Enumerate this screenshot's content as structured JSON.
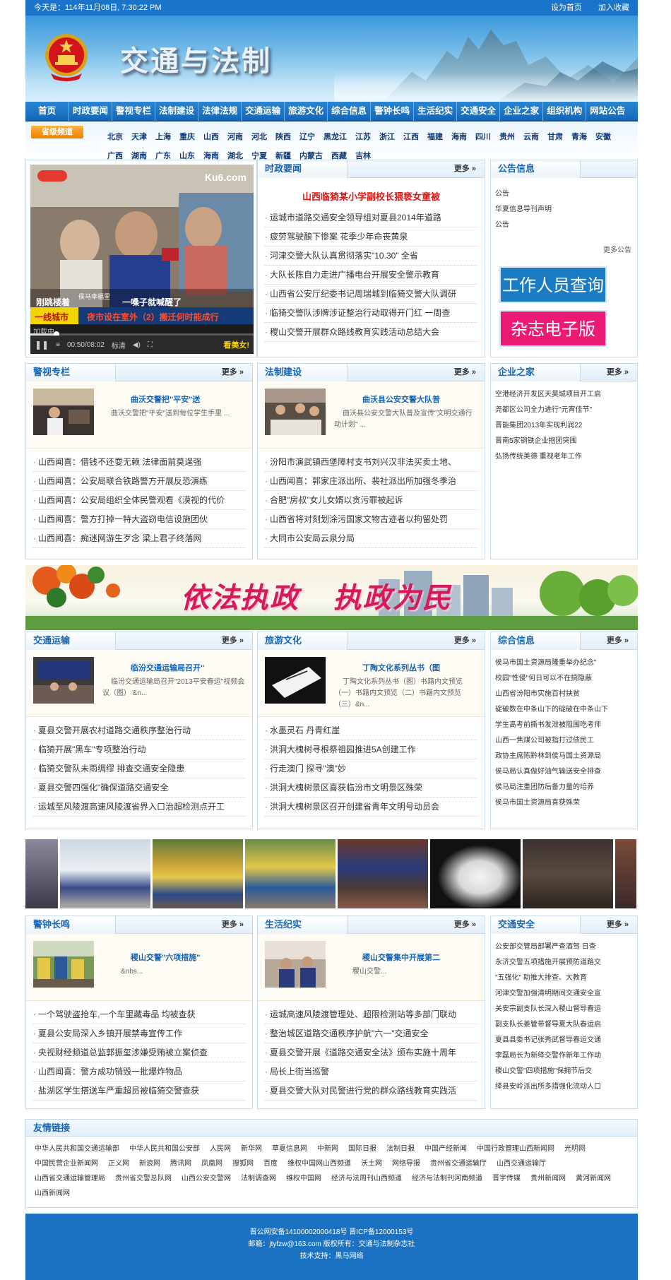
{
  "topbar": {
    "date": "今天是：114年11月08日, 7:30:22 PM",
    "set_home": "设为首页",
    "add_fav": "加入收藏"
  },
  "banner": {
    "title": "交通与法制"
  },
  "nav": [
    "首页",
    "时政要闻",
    "警视专栏",
    "法制建设",
    "法律法规",
    "交通运输",
    "旅游文化",
    "综合信息",
    "警钟长鸣",
    "生活纪实",
    "交通安全",
    "企业之家",
    "组织机构",
    "网站公告"
  ],
  "provinces": {
    "badge": "省级频道",
    "row1": [
      "北京",
      "天津",
      "上海",
      "重庆",
      "山西",
      "河南",
      "河北",
      "陕西",
      "辽宁",
      "黑龙江",
      "江苏",
      "浙江",
      "江西",
      "福建",
      "海南",
      "四川",
      "贵州",
      "云南",
      "甘肃",
      "青海",
      "安徽"
    ],
    "row2": [
      "广西",
      "湖南",
      "广东",
      "山东",
      "海南",
      "湖北",
      "宁夏",
      "新疆",
      "内蒙古",
      "西藏",
      "吉林"
    ]
  },
  "video": {
    "logo": "Ku6.com",
    "news_label": "侯马幸福里",
    "caption_left": "刚跳楼着",
    "caption_right": "一嗓子就喊醒了",
    "ticker_tag": "一线城市",
    "ticker": "夜市设在室外（2）搬迁何时能成行",
    "loading": "加载中",
    "time": "00:50/08:02",
    "quality": "标清",
    "hot": "看美女!"
  },
  "shizheng": {
    "title": "时政要闻",
    "more": "更多",
    "headline": "山西临猗某小学副校长猥亵女童被",
    "items": [
      "运城市道路交通安全领导组对夏县2014年道路",
      "疲劳驾驶酿下惨案 花季少年命丧黄泉",
      "河津交警大队认真贯彻落实\"10.30\" 全省",
      "大队长陈自力走进广播电台开展安全警示教育",
      "山西省公安厅纪委书记周瑞城到临猗交警大队调研",
      "临猗交警队涉牌涉证整治行动取得开门红 一周查",
      "稷山交警开展群众路线教育实践活动总结大会"
    ]
  },
  "notice": {
    "title": "公告信息",
    "items": [
      "公告",
      "华夏信息导刊声明",
      "公告"
    ],
    "more": "更多公告",
    "ad_work": "工作人员查询",
    "ad_mag": "杂志电子版"
  },
  "jingshi": {
    "title": "警视专栏",
    "more": "更多",
    "feat_title": "曲沃交警把\"平安\"送",
    "feat_desc": "曲沃交警把\"平安\"送到每位学生手里   ...",
    "items": [
      "山西闻喜：借钱不还耍无赖 法律面前莫逞强",
      "山西闻喜：公安局联合铁路警方开展反恐演练",
      "山西闻喜：公安局组织全体民警观看《漠视的代价",
      "山西闻喜：警方打掉一特大盗窃电信设施团伙",
      "山西闻喜：痴迷网游生歹念 梁上君子终落网"
    ]
  },
  "fazhi": {
    "title": "法制建设",
    "more": "更多",
    "feat_title": "曲沃县公安交警大队普",
    "feat_desc": "曲沃县公安交警大队普及宣传\"文明交通行动计划\" ...",
    "items": [
      "汾阳市演武镇西堡障村支书刘兴汉非法买卖土地、",
      "山西闻喜：郭家庄派出所、裴社派出所加强冬季治",
      "合肥\"房叔\"女儿女婿以贪污罪被起诉",
      "山西省将对刻划涂污国家文物古迹者以拘留处罚",
      "大同市公安局云泉分局"
    ]
  },
  "qiye": {
    "title": "企业之家",
    "more": "更多",
    "items": [
      "空港经济开发区天昊城项目开工启",
      "尧都区公司全力进行\"元宵佳节\"",
      "晋能集团2013年实现利润22",
      "晋南5家钢铁企业抱团突围",
      "弘扬传统美德 重视老年工作"
    ]
  },
  "ad_band": {
    "slogan1": "依法执政",
    "slogan2": "执政为民"
  },
  "jiaotong": {
    "title": "交通运输",
    "more": "更多",
    "feat_title": "临汾交通运输局召开\"",
    "feat_desc": "临汾交通运输局召开\"2013平安春运\"视频会议（图） &n...",
    "items": [
      "夏县交警开展农村道路交通秩序整治行动",
      "临猗开展\"黑车\"专项整治行动",
      "临猗交警队未雨绸缪 排查交通安全隐患",
      "夏县交警四强化\"确保道路交通安全",
      "运城至风陵渡高速风陵渡省界入口治超检测点开工"
    ]
  },
  "lvyou": {
    "title": "旅游文化",
    "more": "更多",
    "feat_title": "丁陶文化系列丛书（图",
    "feat_desc": "丁陶文化系列丛书（图）书籍内文预览（一）书籍内文预览（二）书籍内文预览（三）&n...",
    "items": [
      "水墨灵石 丹青红崖",
      "洪洞大槐树寻根祭祖园推进5A创建工作",
      "行走澳门 探寻\"澳\"妙",
      "洪洞大槐树景区喜获临汾市文明景区殊荣",
      "洪洞大槐树景区召开创建省青年文明号动员会"
    ]
  },
  "zonghe": {
    "title": "综合信息",
    "more": "更多",
    "items": [
      "侯马市国土资源局隆重举办纪念\"",
      "校园\"性侵\"何日可以不在搞隐蔽",
      "山西省汾阳市实施百村扶贫",
      "碇破数在中条山下的碇破在中条山下",
      "学生高考前撕书发泄被阻围吃考师",
      "山西一焦煤公司被指打过债民工",
      "政协主席陈黔林到侯马国土资源局",
      "侯马局认真做好油气输送安全排查",
      "侯马局注重团防后备力量的培养",
      "侯马市国土资源局喜获殊荣"
    ]
  },
  "jingzhong": {
    "title": "警钟长鸣",
    "more": "更多",
    "feat_title": "稷山交警\"六项措施\"",
    "feat_desc": "&nbs...",
    "items": [
      "一个驾驶盗抢车,一个车里藏毒品 均被查获",
      "夏县公安局深入乡镇开展禁毒宣传工作",
      "央视财经频道总监郭振玺涉嫌受贿被立案侦查",
      "山西闻喜：警方成功销毁一批爆炸物品",
      "盐湖区学生搭送车严重超员被临猗交警查获"
    ]
  },
  "shenghuo": {
    "title": "生活纪实",
    "more": "更多",
    "feat_title": "稷山交警集中开展第二",
    "feat_desc": "稷山交警...",
    "items": [
      "运城高速风陵渡管理处、超限检测站等多部门联动",
      "整治城区道路交通秩序护航\"六一\"交通安全",
      "夏县交警开展《道路交通安全法》颁布实施十周年",
      "局长上街当巡警",
      "夏县交警大队对民警进行党的群众路线教育实践活"
    ]
  },
  "anquan": {
    "title": "交通安全",
    "more": "更多",
    "items": [
      "公安部交管局部署严查酒驾 日查",
      "永济交警五项措施开展预防道路交",
      "\"五强化\" 助推大排查、大教育",
      "河津交警加强清明期间交通安全宣",
      "关安宗副支队长深入稷山督导春运",
      "副支队长姜管带督导夏大队春运启",
      "夏县县委书记张秀武督导春运交通",
      "李磊局长为新绛交警作新年工作动",
      "稷山交警\"四项措施\"保拥节后交",
      "绛县安岭派出所多措强化流动人口"
    ]
  },
  "links": {
    "title": "友情链接",
    "items": [
      "中华人民共和国交通运输部",
      "中华人民共和国公安部",
      "人民网",
      "新华网",
      "草夏信息网",
      "中新网",
      "国际日报",
      "法制日报",
      "中国产经新闻",
      "中国行政管理山西新闻网",
      "光明网",
      "中国民营企业新闻网",
      "正义网",
      "新浪网",
      "腾讯网",
      "凤凰网",
      "搜狐网",
      "百度",
      "维权中国网山西频道",
      "沃土网",
      "网络导报",
      "贵州省交通运输厅",
      "山西交通运输厅",
      "山西省交通运输管理局",
      "贵州省交警总队网",
      "山西公安交警网",
      "法制调查网",
      "维权中国网",
      "经济与法周刊山西频道",
      "经济与法制刊河南频道",
      "晋宇传媒",
      "贵州新闻网",
      "黄河新闻网",
      "山西新闻网"
    ]
  },
  "footer": {
    "line1": "晋公网安备14100002000418号   晋ICP备12000153号",
    "line2": "邮箱：jtyfzw@163.com   版权所有：交通与法制杂志社",
    "line3": "技术支持：黑马网络"
  }
}
